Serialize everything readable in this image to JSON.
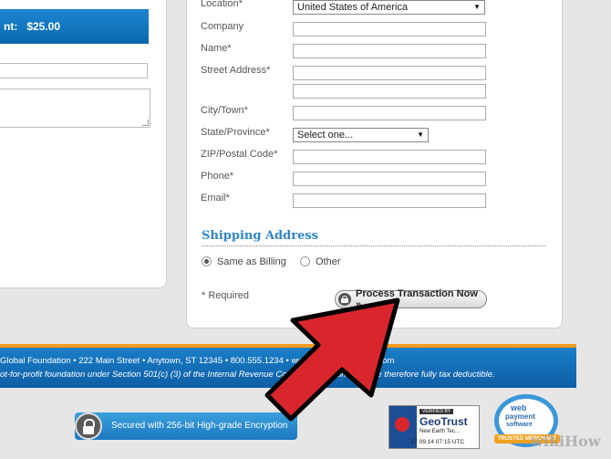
{
  "left": {
    "amount_label": "nt:",
    "amount_value": "$25.00"
  },
  "billing": {
    "fields": {
      "location": {
        "label": "Location*",
        "value": "United States of America"
      },
      "company": {
        "label": "Company"
      },
      "name": {
        "label": "Name*"
      },
      "street": {
        "label": "Street Address*"
      },
      "city": {
        "label": "City/Town*"
      },
      "state": {
        "label": "State/Province*",
        "value": "Select one..."
      },
      "zip": {
        "label": "ZIP/Postal Code*"
      },
      "phone": {
        "label": "Phone*"
      },
      "email": {
        "label": "Email*"
      }
    }
  },
  "shipping": {
    "title": "Shipping Address",
    "options": [
      "Same as Billing",
      "Other"
    ],
    "selected": "Same as Billing"
  },
  "required_note": "* Required",
  "process_button": "Process Transaction Now »",
  "footer": {
    "line1": "Global Foundation • 222 Main Street • Anytown, ST 12345 • 800.555.1234 • www.globalfoundation.com",
    "line2": "ot-for-profit foundation under Section 501(c) (3) of the Internal Revenue Code; contributions to it are therefore fully tax deductible."
  },
  "security_badge": "Secured with 256-bit High-grade Encryption",
  "geotrust": {
    "verified": "VERIFIED BY",
    "brand": "GeoTrust",
    "subject": "New Earth Tec...",
    "click": "CLICK",
    "date": "17.09.14 07:15 UTC"
  },
  "web_payment_seal": {
    "line1": "web",
    "line2": "payment",
    "line3": "software",
    "ribbon": "TRUSTED MERCHANT"
  },
  "watermark": "wikiHow",
  "colors": {
    "accent": "#2f86c8",
    "footer_blue": "#0e5ea5",
    "footer_orange": "#f39c1f",
    "arrow_red": "#d8262c"
  }
}
